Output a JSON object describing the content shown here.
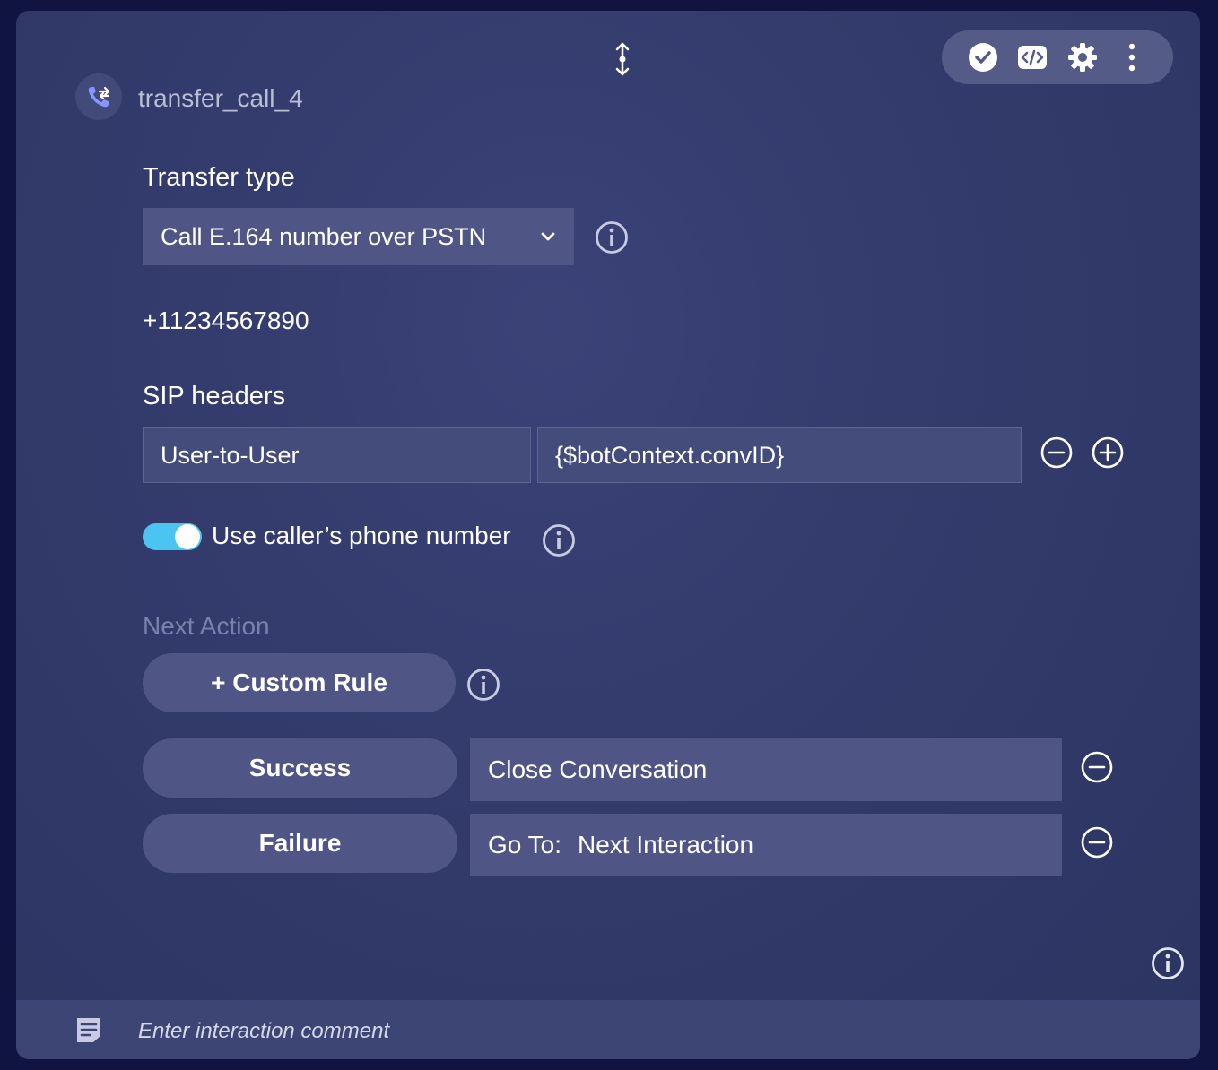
{
  "header": {
    "node_title": "transfer_call_4",
    "node_icon": "phone-transfer-icon",
    "drag_icon": "vertical-resize-icon",
    "toolbar": [
      "check-icon",
      "code-icon",
      "gear-icon",
      "more-vertical-icon"
    ]
  },
  "transfer": {
    "label": "Transfer type",
    "selected": "Call E.164 number over PSTN",
    "phone_number": "+11234567890"
  },
  "sip": {
    "label": "SIP headers",
    "header_name": "User-to-User",
    "header_value": "{$botContext.convID}"
  },
  "caller_toggle": {
    "label": "Use caller’s phone number",
    "enabled": true
  },
  "next_action": {
    "label": "Next Action",
    "custom_rule_button": "+ Custom Rule",
    "rules": [
      {
        "name": "Success",
        "action": "Close Conversation"
      },
      {
        "name": "Failure",
        "action_prefix": "Go To:",
        "action": "Next Interaction"
      }
    ]
  },
  "footer": {
    "comment_placeholder": "Enter interaction comment"
  },
  "colors": {
    "accent_toggle": "#4cc4f2",
    "card_bg": "#333b6c",
    "field_bg": "#4f5685"
  }
}
